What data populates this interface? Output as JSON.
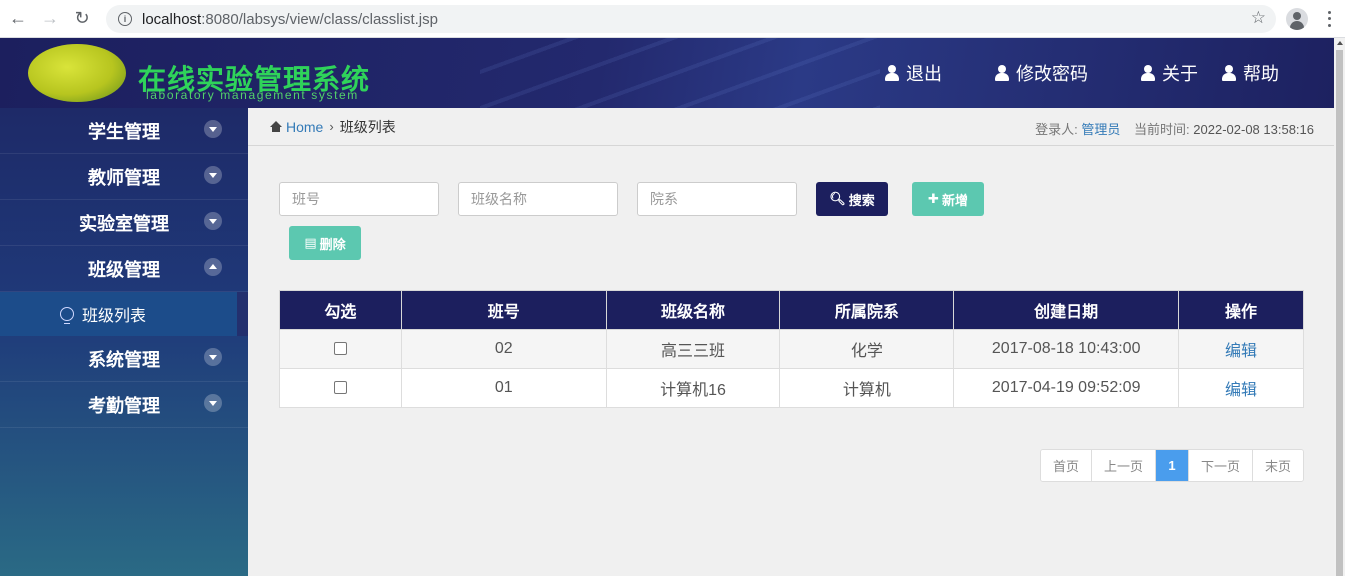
{
  "browser": {
    "url_host": "localhost",
    "url_rest": ":8080/labsys/view/class/classlist.jsp"
  },
  "header": {
    "logo_title": "在线实验管理系统",
    "logo_subtitle": "laboratory management system",
    "links": [
      "退出",
      "修改密码",
      "关于",
      "帮助"
    ]
  },
  "sidebar": {
    "items": [
      {
        "label": "学生管理",
        "expanded": false
      },
      {
        "label": "教师管理",
        "expanded": false
      },
      {
        "label": "实验室管理",
        "expanded": false
      },
      {
        "label": "班级管理",
        "expanded": true,
        "sub": [
          "班级列表"
        ]
      },
      {
        "label": "系统管理",
        "expanded": false
      },
      {
        "label": "考勤管理",
        "expanded": false
      }
    ]
  },
  "breadcrumb": {
    "home": "Home",
    "current": "班级列表"
  },
  "login": {
    "label": "登录人:",
    "user": "管理员",
    "time_label": "当前时间:",
    "time": "2022-02-08 13:58:16"
  },
  "search": {
    "class_no_placeholder": "班号",
    "class_name_placeholder": "班级名称",
    "department_placeholder": "院系",
    "search_label": "搜索",
    "add_label": "新增",
    "delete_label": "删除"
  },
  "table": {
    "headers": [
      "勾选",
      "班号",
      "班级名称",
      "所属院系",
      "创建日期",
      "操作"
    ],
    "rows": [
      {
        "class_no": "02",
        "class_name": "高三三班",
        "department": "化学",
        "created": "2017-08-18 10:43:00",
        "action": "编辑"
      },
      {
        "class_no": "01",
        "class_name": "计算机16",
        "department": "计算机",
        "created": "2017-04-19 09:52:09",
        "action": "编辑"
      }
    ]
  },
  "pagination": {
    "first": "首页",
    "prev": "上一页",
    "current": "1",
    "next": "下一页",
    "last": "末页"
  }
}
